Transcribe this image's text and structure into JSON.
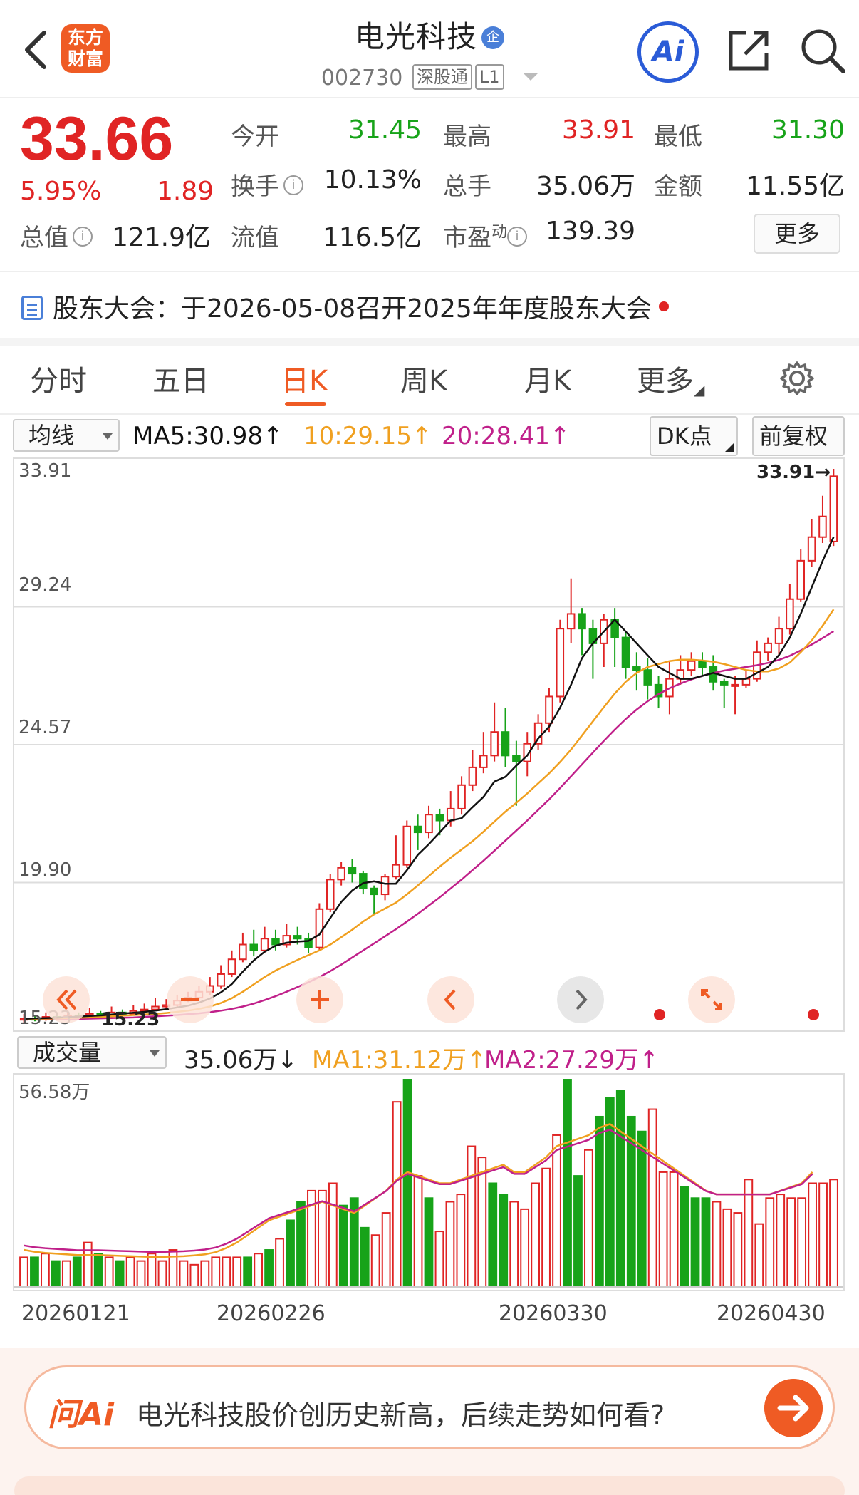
{
  "header": {
    "logo_line1": "东方",
    "logo_line2": "财富",
    "title": "电光科技",
    "title_badge": "企",
    "code": "002730",
    "tag1": "深股通",
    "tag2": "L1",
    "ai_label": "Ai"
  },
  "quote": {
    "price": "33.66",
    "change_pct": "5.95%",
    "change": "1.89",
    "open_label": "今开",
    "open": "31.45",
    "high_label": "最高",
    "high": "33.91",
    "low_label": "最低",
    "low": "31.30",
    "turnover_label": "换手",
    "turnover": "10.13%",
    "volume_label": "总手",
    "volume": "35.06万",
    "amount_label": "金额",
    "amount": "11.55亿",
    "mktcap_label": "总值",
    "mktcap": "121.9亿",
    "float_label": "流值",
    "float_cap": "116.5亿",
    "pe_label": "市盈",
    "pe_sup": "动",
    "pe": "139.39",
    "more_label": "更多",
    "info_icon": "i"
  },
  "notice": {
    "text": "股东大会：于2026-05-08召开2025年年度股东大会"
  },
  "tabs": {
    "items": [
      "分时",
      "五日",
      "日K",
      "周K",
      "月K",
      "更多"
    ],
    "active_index": 2
  },
  "ma_bar": {
    "select": "均线",
    "ma5": "MA5:30.98↑",
    "ma10": "10:29.15↑",
    "ma20": "20:28.41↑",
    "dk": "DK点",
    "adj": "前复权"
  },
  "volume_bar": {
    "select": "成交量",
    "vol": "35.06万↓",
    "ma1": "MA1:31.12万↑",
    "ma2": "MA2:27.29万↑"
  },
  "colors": {
    "up": "#e02424",
    "down": "#17a319",
    "ma5": "#111111",
    "ma10": "#f0a020",
    "ma20": "#c0208a",
    "brand": "#ef5b24"
  },
  "chart_data": {
    "type": "candlestick",
    "y_ticks": [
      "33.91",
      "29.24",
      "24.57",
      "19.90",
      "15.23"
    ],
    "ylim": [
      15.23,
      33.91
    ],
    "last_high_label": "33.91→",
    "low_label": "15.23",
    "candles": [
      [
        15.25,
        15.3,
        15.45,
        15.15
      ],
      [
        15.3,
        15.28,
        15.4,
        15.2
      ],
      [
        15.28,
        15.35,
        15.5,
        15.22
      ],
      [
        15.35,
        15.3,
        15.45,
        15.25
      ],
      [
        15.3,
        15.4,
        15.6,
        15.25
      ],
      [
        15.4,
        15.38,
        15.5,
        15.3
      ],
      [
        15.38,
        15.45,
        15.65,
        15.32
      ],
      [
        15.45,
        15.4,
        15.55,
        15.35
      ],
      [
        15.4,
        15.5,
        15.7,
        15.35
      ],
      [
        15.5,
        15.45,
        15.6,
        15.4
      ],
      [
        15.45,
        15.55,
        15.75,
        15.4
      ],
      [
        15.55,
        15.6,
        15.8,
        15.5
      ],
      [
        15.6,
        15.7,
        16.0,
        15.55
      ],
      [
        15.7,
        15.75,
        15.95,
        15.6
      ],
      [
        15.75,
        15.9,
        16.1,
        15.7
      ],
      [
        15.9,
        16.0,
        16.2,
        15.85
      ],
      [
        16.0,
        16.2,
        16.4,
        15.95
      ],
      [
        16.2,
        16.4,
        16.7,
        16.1
      ],
      [
        16.4,
        16.8,
        17.1,
        16.3
      ],
      [
        16.8,
        17.3,
        17.6,
        16.7
      ],
      [
        17.3,
        17.8,
        18.2,
        17.2
      ],
      [
        17.8,
        17.6,
        18.3,
        17.4
      ],
      [
        17.6,
        18.0,
        18.4,
        17.5
      ],
      [
        18.0,
        17.8,
        18.3,
        17.6
      ],
      [
        17.8,
        18.1,
        18.5,
        17.7
      ],
      [
        18.1,
        18.0,
        18.4,
        17.8
      ],
      [
        18.0,
        17.7,
        18.2,
        17.5
      ],
      [
        17.7,
        19.0,
        19.2,
        17.6
      ],
      [
        19.0,
        20.0,
        20.2,
        18.9
      ],
      [
        20.0,
        20.4,
        20.6,
        19.8
      ],
      [
        20.4,
        20.2,
        20.7,
        19.9
      ],
      [
        20.2,
        19.7,
        20.3,
        19.5
      ],
      [
        19.7,
        19.5,
        19.8,
        18.8
      ],
      [
        19.5,
        20.1,
        20.2,
        19.3
      ],
      [
        20.1,
        20.5,
        21.5,
        20.0
      ],
      [
        20.5,
        21.8,
        22.0,
        20.4
      ],
      [
        21.8,
        21.6,
        22.2,
        21.0
      ],
      [
        21.6,
        22.2,
        22.5,
        21.4
      ],
      [
        22.2,
        22.0,
        22.4,
        21.5
      ],
      [
        22.0,
        22.4,
        23.0,
        21.8
      ],
      [
        22.4,
        23.2,
        23.5,
        22.2
      ],
      [
        23.2,
        23.8,
        24.4,
        23.0
      ],
      [
        23.8,
        24.2,
        25.0,
        23.6
      ],
      [
        24.2,
        25.0,
        26.0,
        24.0
      ],
      [
        25.0,
        24.2,
        25.8,
        23.8
      ],
      [
        24.2,
        24.0,
        24.7,
        22.5
      ],
      [
        24.0,
        24.6,
        25.0,
        23.5
      ],
      [
        24.6,
        25.3,
        25.6,
        24.4
      ],
      [
        25.3,
        26.2,
        26.5,
        25.0
      ],
      [
        26.2,
        28.5,
        28.8,
        26.0
      ],
      [
        28.5,
        29.0,
        30.2,
        28.0
      ],
      [
        29.0,
        28.5,
        29.2,
        27.6
      ],
      [
        28.5,
        28.0,
        28.8,
        26.8
      ],
      [
        28.0,
        28.8,
        29.0,
        27.2
      ],
      [
        28.8,
        28.2,
        29.2,
        27.2
      ],
      [
        28.2,
        27.2,
        28.4,
        26.8
      ],
      [
        27.2,
        27.1,
        27.7,
        26.4
      ],
      [
        27.1,
        26.6,
        27.5,
        26.1
      ],
      [
        26.6,
        26.2,
        26.9,
        25.8
      ],
      [
        26.2,
        26.8,
        27.4,
        25.6
      ],
      [
        26.8,
        27.1,
        27.6,
        26.6
      ],
      [
        27.1,
        27.4,
        27.7,
        26.9
      ],
      [
        27.4,
        27.2,
        27.7,
        26.9
      ],
      [
        27.2,
        26.7,
        27.6,
        26.4
      ],
      [
        26.7,
        26.6,
        26.8,
        25.8
      ],
      [
        26.6,
        26.6,
        26.9,
        25.6
      ],
      [
        26.6,
        26.8,
        27.1,
        26.5
      ],
      [
        26.8,
        27.7,
        28.1,
        26.7
      ],
      [
        27.7,
        28.0,
        28.2,
        27.4
      ],
      [
        28.0,
        28.5,
        28.9,
        27.6
      ],
      [
        28.5,
        29.5,
        30.0,
        28.3
      ],
      [
        29.5,
        30.8,
        31.2,
        29.4
      ],
      [
        30.8,
        31.6,
        32.2,
        30.6
      ],
      [
        31.6,
        32.3,
        33.0,
        31.4
      ],
      [
        31.45,
        33.66,
        33.91,
        31.3
      ]
    ],
    "ma5": [
      15.28,
      15.3,
      15.31,
      15.32,
      15.34,
      15.36,
      15.38,
      15.4,
      15.43,
      15.46,
      15.49,
      15.52,
      15.56,
      15.61,
      15.67,
      15.73,
      15.83,
      15.97,
      16.18,
      16.46,
      16.88,
      17.26,
      17.56,
      17.76,
      17.86,
      17.9,
      17.92,
      18.14,
      18.7,
      19.24,
      19.63,
      19.88,
      19.94,
      19.86,
      19.86,
      20.32,
      20.84,
      21.2,
      21.6,
      22.0,
      22.08,
      22.45,
      22.8,
      23.32,
      23.48,
      23.86,
      24.2,
      24.78,
      25.18,
      25.82,
      26.6,
      27.5,
      28.0,
      28.4,
      28.8,
      28.4,
      28.0,
      27.6,
      27.2,
      27.0,
      26.8,
      26.8,
      26.9,
      27.0,
      26.9,
      26.8,
      26.8,
      27.0,
      27.2,
      27.6,
      28.2,
      29.0,
      29.9,
      30.8,
      31.6
    ],
    "ma10": [
      15.27,
      15.28,
      15.29,
      15.3,
      15.31,
      15.32,
      15.33,
      15.35,
      15.37,
      15.39,
      15.41,
      15.43,
      15.45,
      15.48,
      15.52,
      15.56,
      15.62,
      15.7,
      15.82,
      15.98,
      16.2,
      16.45,
      16.7,
      16.92,
      17.1,
      17.28,
      17.44,
      17.6,
      17.8,
      18.05,
      18.3,
      18.58,
      18.82,
      19.02,
      19.22,
      19.5,
      19.8,
      20.12,
      20.44,
      20.74,
      21.02,
      21.3,
      21.62,
      21.96,
      22.3,
      22.6,
      22.92,
      23.26,
      23.6,
      23.98,
      24.4,
      24.88,
      25.36,
      25.84,
      26.3,
      26.7,
      27.0,
      27.2,
      27.3,
      27.4,
      27.45,
      27.45,
      27.42,
      27.38,
      27.3,
      27.2,
      27.1,
      27.05,
      27.05,
      27.15,
      27.35,
      27.7,
      28.1,
      28.6,
      29.15
    ],
    "ma20": [
      15.26,
      15.26,
      15.27,
      15.27,
      15.28,
      15.28,
      15.29,
      15.3,
      15.31,
      15.32,
      15.33,
      15.35,
      15.37,
      15.39,
      15.41,
      15.44,
      15.47,
      15.51,
      15.56,
      15.62,
      15.7,
      15.8,
      15.92,
      16.05,
      16.2,
      16.36,
      16.52,
      16.7,
      16.9,
      17.12,
      17.36,
      17.6,
      17.84,
      18.08,
      18.32,
      18.58,
      18.84,
      19.12,
      19.4,
      19.7,
      20.0,
      20.32,
      20.64,
      20.98,
      21.32,
      21.66,
      22.0,
      22.36,
      22.72,
      23.1,
      23.5,
      23.9,
      24.3,
      24.7,
      25.08,
      25.44,
      25.76,
      26.04,
      26.28,
      26.48,
      26.64,
      26.78,
      26.9,
      27.0,
      27.08,
      27.14,
      27.2,
      27.26,
      27.34,
      27.44,
      27.58,
      27.76,
      27.96,
      28.18,
      28.41
    ]
  },
  "volume_data": {
    "max_label": "56.58万",
    "ymax": 56.58,
    "dates": [
      "20260121",
      "20260226",
      "20260330",
      "20260430"
    ],
    "values": [
      8,
      8,
      9,
      7,
      7,
      8,
      12,
      9,
      8,
      7,
      8,
      7,
      9,
      7,
      10,
      7,
      6,
      7,
      8,
      8,
      8,
      8,
      9,
      10,
      13,
      18,
      23,
      26,
      26,
      28,
      22,
      24,
      16,
      14,
      20,
      50,
      56,
      30,
      24,
      15,
      23,
      25,
      38,
      35,
      28,
      25,
      23,
      21,
      28,
      32,
      41,
      56,
      30,
      37,
      46,
      51,
      53,
      46,
      42,
      48,
      31,
      31,
      27,
      24,
      24,
      23,
      21,
      20,
      29,
      17,
      24,
      25,
      24,
      24,
      28,
      28,
      29
    ],
    "ma1": [
      10,
      9.5,
      9.2,
      9,
      8.8,
      8.6,
      8.6,
      8.6,
      8.5,
      8.4,
      8.3,
      8.2,
      8.1,
      8.1,
      8.2,
      8.3,
      8.5,
      8.8,
      9.4,
      10.5,
      12,
      14,
      16,
      18,
      19,
      20,
      21,
      22,
      23,
      22,
      21,
      20,
      22,
      24,
      26,
      29,
      31,
      30,
      29,
      28,
      28,
      29,
      30,
      31,
      32,
      33,
      31,
      31,
      33,
      35,
      38,
      39,
      40,
      41,
      43,
      44,
      42,
      40,
      38,
      36,
      34,
      32,
      30,
      28,
      26,
      25,
      25,
      25,
      25,
      25,
      25,
      26,
      27,
      28,
      31
    ]
  }
}
